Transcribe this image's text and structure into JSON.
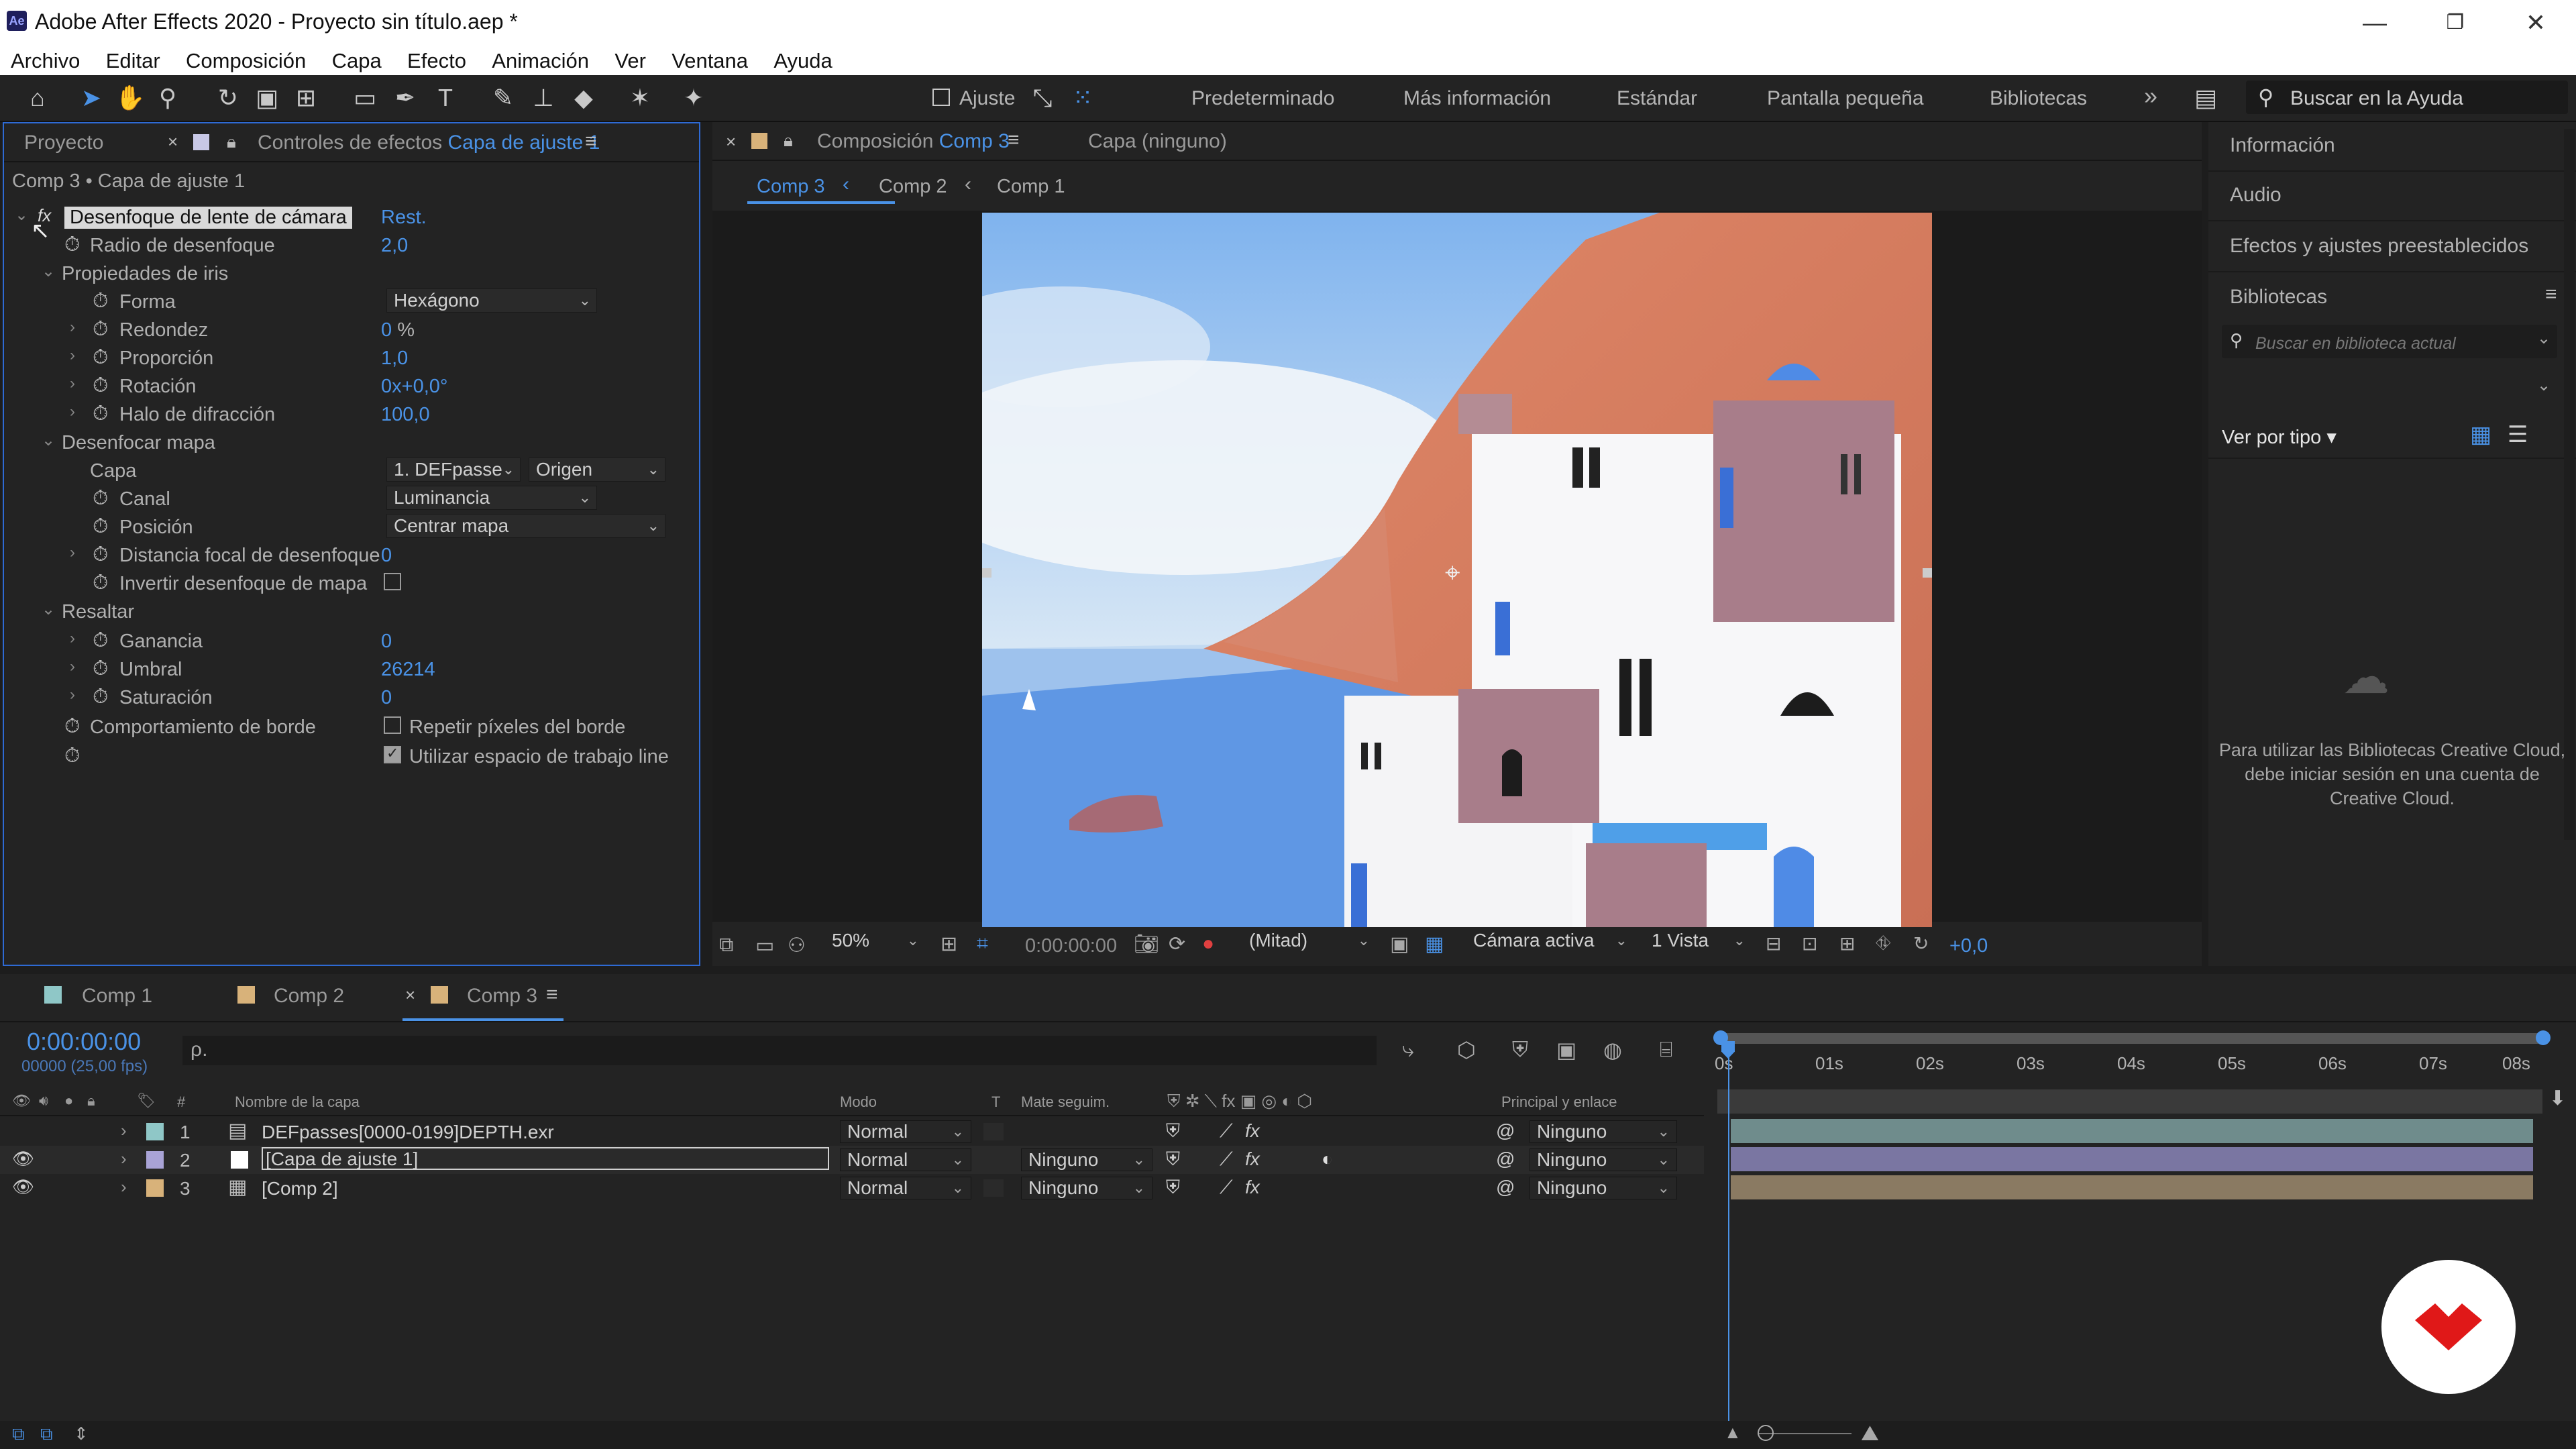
{
  "app": {
    "title": "Adobe After Effects 2020 - Proyecto sin título.aep *",
    "logo_text": "Ae",
    "window_controls": [
      "minimize-icon",
      "restore-icon",
      "close-icon"
    ]
  },
  "menu": [
    "Archivo",
    "Editar",
    "Composición",
    "Capa",
    "Efecto",
    "Animación",
    "Ver",
    "Ventana",
    "Ayuda"
  ],
  "toolbar": {
    "snap_label": "Ajuste",
    "workspaces": [
      "Predeterminado",
      "Más información",
      "Estándar",
      "Pantalla pequeña",
      "Bibliotecas"
    ],
    "more": "»",
    "help_placeholder": "Buscar en la Ayuda"
  },
  "effects_panel": {
    "tab_project": "Proyecto",
    "tab_title": "Controles de efectos",
    "tab_layer": "Capa de ajuste 1",
    "subtitle": "Comp 3 • Capa de ajuste 1",
    "effect_name": "Desenfoque de lente de cámara",
    "reset": "Rest.",
    "props": {
      "radio": {
        "label": "Radio de desenfoque",
        "value": "2,0"
      },
      "iris": {
        "label": "Propiedades de iris"
      },
      "forma": {
        "label": "Forma",
        "value": "Hexágono"
      },
      "redondez": {
        "label": "Redondez",
        "value": "0",
        "unit": "%"
      },
      "proporcion": {
        "label": "Proporción",
        "value": "1,0"
      },
      "rotacion": {
        "label": "Rotación",
        "value": "0",
        "value2": "x+0,0°"
      },
      "halo": {
        "label": "Halo de difracción",
        "value": "100,0"
      },
      "mapa": {
        "label": "Desenfocar mapa"
      },
      "capa": {
        "label": "Capa",
        "value": "1. DEFpasse",
        "value2": "Origen"
      },
      "canal": {
        "label": "Canal",
        "value": "Luminancia"
      },
      "posicion": {
        "label": "Posición",
        "value": "Centrar mapa"
      },
      "distancia": {
        "label": "Distancia focal de desenfoque",
        "value": "0"
      },
      "invertir": {
        "label": "Invertir desenfoque de mapa",
        "checked": false
      },
      "resaltar": {
        "label": "Resaltar"
      },
      "ganancia": {
        "label": "Ganancia",
        "value": "0"
      },
      "umbral": {
        "label": "Umbral",
        "value": "26214"
      },
      "saturacion": {
        "label": "Saturación",
        "value": "0"
      },
      "borde": {
        "label": "Comportamiento de borde",
        "value": "Repetir píxeles del borde",
        "checked": false
      },
      "lineal": {
        "value": "Utilizar espacio de trabajo line",
        "checked": true
      }
    }
  },
  "comp_panel": {
    "tab_title": "Composición",
    "tab_comp": "Comp 3",
    "layer_tab": "Capa  (ninguno)",
    "breadcrumbs": [
      "Comp 3",
      "Comp 2",
      "Comp 1"
    ],
    "footer": {
      "zoom": "50%",
      "timecode": "0:00:00:00",
      "resolution": "(Mitad)",
      "camera": "Cámara activa",
      "views": "1 Vista",
      "exposure": "+0,0"
    }
  },
  "right_panel": {
    "sections": [
      "Información",
      "Audio",
      "Efectos y ajustes preestablecidos",
      "Bibliotecas"
    ],
    "lib_search_placeholder": "Buscar en biblioteca actual",
    "view_by": "Ver por tipo",
    "cc_message": "Para utilizar las Bibliotecas Creative Cloud, debe iniciar sesión en una cuenta de Creative Cloud."
  },
  "timeline": {
    "tabs": [
      "Comp 1",
      "Comp 2",
      "Comp 3"
    ],
    "timecode": "0:00:00:00",
    "fps": "00000 (25,00 fps)",
    "search_placeholder": "ρ.",
    "headers": {
      "num": "#",
      "name": "Nombre de la capa",
      "mode": "Modo",
      "t": "T",
      "matte": "Mate seguim.",
      "parent": "Principal y enlace"
    },
    "ruler": [
      "0s",
      "01s",
      "02s",
      "03s",
      "04s",
      "05s",
      "06s",
      "07s",
      "08s"
    ],
    "layers": [
      {
        "num": "1",
        "name": "DEFpasses[0000-0199]DEPTH.exr",
        "mode": "Normal",
        "matte": "",
        "parent": "Ninguno",
        "label_color": "#8fc7c7",
        "bar_color": "#6f8c8c"
      },
      {
        "num": "2",
        "name": "[Capa de ajuste 1]",
        "mode": "Normal",
        "matte": "Ninguno",
        "parent": "Ninguno",
        "label_color": "#a9a3d6",
        "bar_color": "#7a76a2"
      },
      {
        "num": "3",
        "name": "[Comp 2]",
        "mode": "Normal",
        "matte": "Ninguno",
        "parent": "Ninguno",
        "label_color": "#d8b27a",
        "bar_color": "#8a7a62"
      }
    ]
  },
  "colors": {
    "accent": "#4a92e6",
    "panel": "#232323",
    "bg": "#1d1d1d"
  }
}
